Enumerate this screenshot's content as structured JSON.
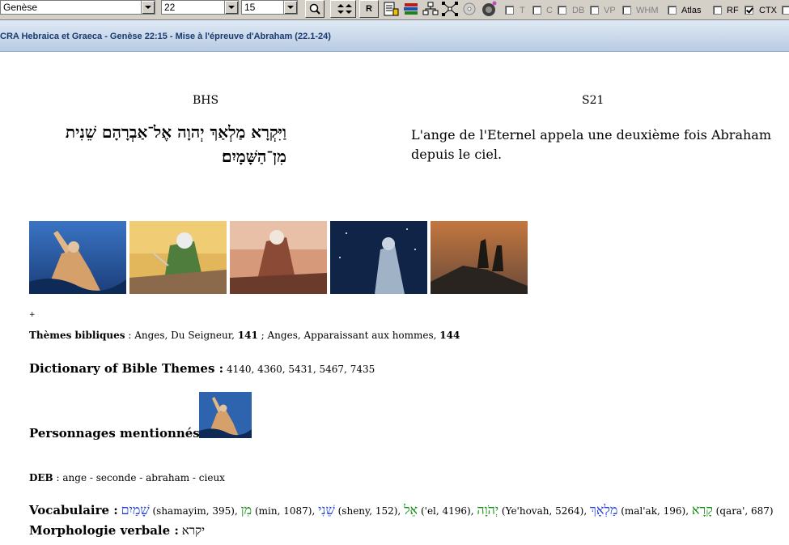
{
  "toolbar": {
    "book": "Genèse",
    "chapter": "22",
    "verse": "15",
    "r_label": "R",
    "checkboxes": [
      {
        "label": "T",
        "checked": false
      },
      {
        "label": "C",
        "checked": false
      },
      {
        "label": "DB",
        "checked": false
      },
      {
        "label": "VP",
        "checked": false
      },
      {
        "label": "WHM",
        "checked": false
      },
      {
        "label": "Atlas",
        "checked": false
      },
      {
        "label": "RF",
        "checked": true
      },
      {
        "label": "CTX",
        "checked": false
      }
    ]
  },
  "window": {
    "title": "CRA Hebraica et Graeca - Genèse 22:15 - Mise à l'épreuve d'Abraham (22.1-24)"
  },
  "columns": {
    "left_header": "BHS",
    "right_header": "S21",
    "hebrew_text": "וַיִּקְרָא מַלְאַךְ יְהוָה אֶל־אַבְרָהָם שֵׁנִית מִן־הַשָּׁמָיִם׃",
    "french_text": "L'ange de l'Eternel appela une deuxième fois Abraham depuis le ciel."
  },
  "images": [
    {
      "name": "abraham-looking-up",
      "colors": [
        "#2a5ea8",
        "#c9935c"
      ]
    },
    {
      "name": "abraham-with-knife",
      "colors": [
        "#d8a640",
        "#4e7a3a"
      ]
    },
    {
      "name": "isaac-on-altar",
      "colors": [
        "#c98a6a",
        "#7a3a2a"
      ]
    },
    {
      "name": "abraham-night-sky",
      "colors": [
        "#0e2346",
        "#a0b4c8"
      ]
    },
    {
      "name": "mountain-silhouette",
      "colors": [
        "#b06a3a",
        "#2a2a2a"
      ]
    }
  ],
  "plus_marker": "+",
  "themes": {
    "label": "Thèmes bibliques",
    "colon": " : ",
    "item1": "Anges, Du Seigneur, ",
    "num1": "141",
    "sep": " ; ",
    "item2": "Anges, Apparaissant aux hommes, ",
    "num2": "144"
  },
  "dictionary": {
    "label": "Dictionary of Bible Themes :",
    "values": "4140, 4360, 5431, 5467, 7435"
  },
  "personnages": {
    "label": "Personnages mentionnés :",
    "marker": "+"
  },
  "deb": {
    "label": "DEB",
    "values": " : ange - seconde - abraham - cieux"
  },
  "vocabulaire": {
    "label": "Vocabulaire :",
    "items": [
      {
        "hebrew": "שָׁמַיִם",
        "info": " (shamayim, 395), ",
        "color": "blue"
      },
      {
        "hebrew": "מִן",
        "info": " (min, 1087), ",
        "color": "green"
      },
      {
        "hebrew": "שֵׁנִי",
        "info": " (sheny, 152), ",
        "color": "blue"
      },
      {
        "hebrew": "אֵל",
        "info": " ('el, 4196), ",
        "color": "green"
      },
      {
        "hebrew": "יְהֹוָה",
        "info": " (Ye'hovah, 5264), ",
        "color": "green"
      },
      {
        "hebrew": "מַלְאָךְ",
        "info": " (mal'ak, 196), ",
        "color": "blue"
      },
      {
        "hebrew": "קָרָא",
        "info": " (qara', 687)",
        "color": "green"
      }
    ]
  },
  "morphologie": {
    "label": "Morphologie verbale :",
    "value": "יקרא"
  }
}
